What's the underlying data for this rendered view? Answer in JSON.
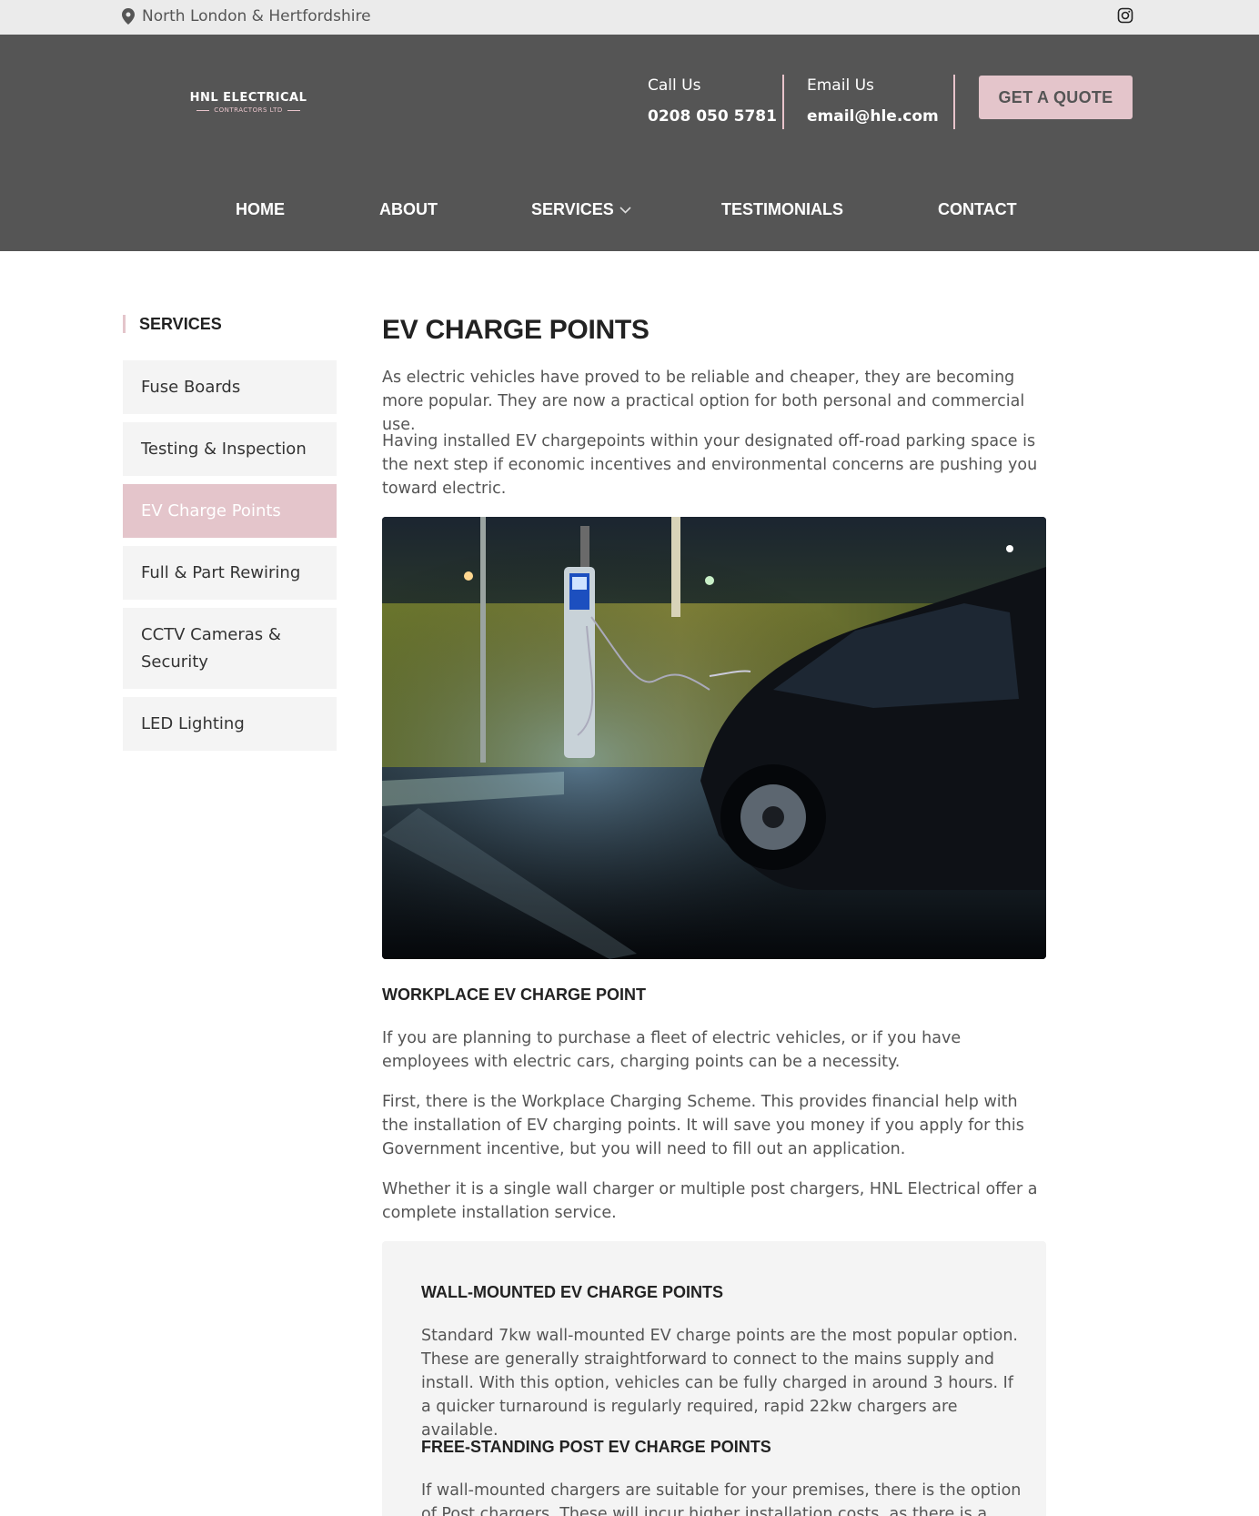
{
  "topbar": {
    "location": "North London & Hertfordshire",
    "location_icon": "map-pin-icon",
    "social_icon": "instagram-icon"
  },
  "header": {
    "logo_line1": "HNL ELECTRICAL",
    "logo_line2": "CONTRACTORS LTD",
    "call_label": "Call Us",
    "call_value": "0208 050 5781",
    "email_label": "Email Us",
    "email_value": "email@hle.com",
    "quote_button": "GET A QUOTE"
  },
  "nav": {
    "items": [
      "HOME",
      "ABOUT",
      "SERVICES",
      "TESTIMONIALS",
      "CONTACT"
    ]
  },
  "sidebar": {
    "title": "SERVICES",
    "items": [
      {
        "label": "Fuse Boards"
      },
      {
        "label": "Testing & Inspection"
      },
      {
        "label": "EV Charge Points",
        "active": true
      },
      {
        "label": "Full & Part Rewiring"
      },
      {
        "label": "CCTV Cameras & Security"
      },
      {
        "label": "LED Lighting"
      }
    ]
  },
  "main": {
    "title": "EV CHARGE POINTS",
    "intro_p1": "As electric vehicles have proved to be reliable and cheaper, they are becoming more popular. They are now a practical option for both personal and commercial use.",
    "intro_p2": "Having installed EV chargepoints within your designated off-road parking space is the next step if economic incentives and environmental concerns are pushing you toward electric.",
    "workplace_heading": "WORKPLACE EV CHARGE POINT",
    "workplace_p1": "If you are planning to purchase a fleet of electric vehicles, or if you have employees with electric cars, charging points can be a necessity.",
    "workplace_p2": "First, there is the Workplace Charging Scheme. This provides financial help with the installation of EV charging points. It will save you money if you apply for this Government incentive, but you will need to fill out an application.",
    "workplace_p3": "Whether it is a single wall charger or multiple post chargers, HNL Electrical offer a complete installation service.",
    "box": {
      "wall_heading": "WALL-MOUNTED EV CHARGE POINTS",
      "wall_text": "Standard 7kw wall-mounted EV charge points are the most popular option. These are generally straightforward to connect to the mains supply and install. With this option, vehicles can be fully charged in around 3 hours. If a quicker turnaround is regularly required, rapid 22kw chargers are available.",
      "post_heading": "FREE-STANDING POST EV CHARGE POINTS",
      "post_text": "If wall-mounted chargers are suitable for your premises, there is the option of Post chargers. These will incur higher installation costs, as there is a need"
    }
  },
  "colors": {
    "header_bg": "#555555",
    "topbar_bg": "#ebebeb",
    "accent_pink": "#e4c5cb",
    "sidebar_item_bg": "#f4f4f4"
  }
}
